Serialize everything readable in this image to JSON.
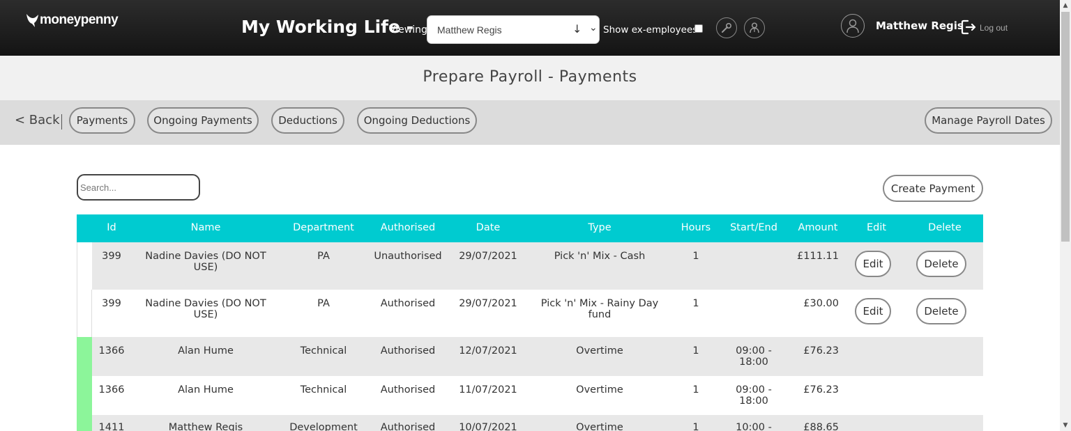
{
  "header": {
    "logo_text": "moneypenny",
    "app_title": "My Working Life -",
    "viewing_label": "Viewing",
    "employee_select_value": "Matthew Regis",
    "show_ex_employees_label": "Show ex-employees",
    "user_name": "Matthew Regis",
    "logout_label": "Log out"
  },
  "page": {
    "title": "Prepare Payroll - Payments"
  },
  "nav": {
    "back_label": "< Back",
    "tabs": [
      "Payments",
      "Ongoing Payments",
      "Deductions",
      "Ongoing Deductions"
    ],
    "manage_label": "Manage Payroll Dates"
  },
  "toolbar": {
    "search_placeholder": "Search...",
    "create_label": "Create Payment"
  },
  "table": {
    "columns": [
      "Id",
      "Name",
      "Department",
      "Authorised",
      "Date",
      "Type",
      "Hours",
      "Start/End",
      "Amount",
      "Edit",
      "Delete"
    ],
    "edit_label": "Edit",
    "delete_label": "Delete",
    "rows": [
      {
        "id": "399",
        "name": "Nadine Davies (DO NOT USE)",
        "department": "PA",
        "authorised": "Unauthorised",
        "date": "29/07/2021",
        "type": "Pick 'n' Mix - Cash",
        "hours": "1",
        "start_end": "",
        "amount": "£111.11",
        "marker_color": "#ffffff"
      },
      {
        "id": "399",
        "name": "Nadine Davies (DO NOT USE)",
        "department": "PA",
        "authorised": "Authorised",
        "date": "29/07/2021",
        "type": "Pick 'n' Mix - Rainy Day fund",
        "hours": "1",
        "start_end": "",
        "amount": "£30.00",
        "marker_color": "#ffffff"
      },
      {
        "id": "1366",
        "name": "Alan Hume",
        "department": "Technical",
        "authorised": "Authorised",
        "date": "12/07/2021",
        "type": "Overtime",
        "hours": "1",
        "start_end": "09:00 - 18:00",
        "amount": "£76.23",
        "marker_color": "#8cf59a"
      },
      {
        "id": "1366",
        "name": "Alan Hume",
        "department": "Technical",
        "authorised": "Authorised",
        "date": "11/07/2021",
        "type": "Overtime",
        "hours": "1",
        "start_end": "09:00 - 18:00",
        "amount": "£76.23",
        "marker_color": "#8cf59a"
      },
      {
        "id": "1411",
        "name": "Matthew Regis",
        "department": "Development",
        "authorised": "Authorised",
        "date": "10/07/2021",
        "type": "Overtime",
        "hours": "1",
        "start_end": "10:00 -",
        "amount": "£88.65",
        "marker_color": "#8cf59a"
      }
    ]
  },
  "colors": {
    "header_bg": "#1e1e1e",
    "table_header_bg": "#00cbd0",
    "row_alt_bg": "#e8e8e8",
    "authorised_marker": "#8cf59a"
  }
}
